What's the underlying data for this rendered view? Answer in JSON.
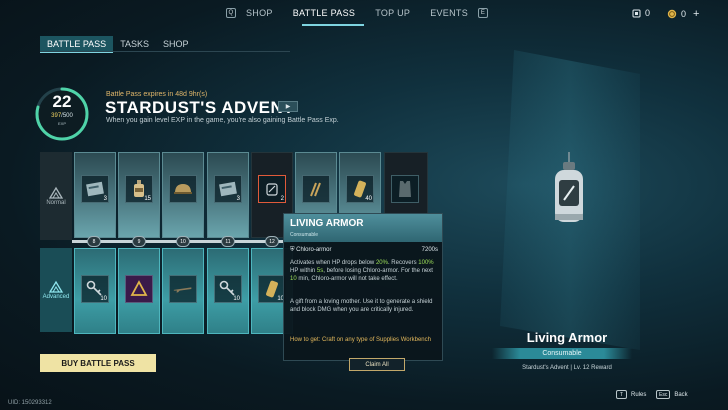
{
  "nav": {
    "left_key": "Q",
    "right_key": "E",
    "items": [
      "SHOP",
      "BATTLE PASS",
      "TOP UP",
      "EVENTS"
    ],
    "active_index": 1
  },
  "currency": [
    {
      "icon": "ticket-icon",
      "value": "0"
    },
    {
      "icon": "coin-icon",
      "value": "0"
    }
  ],
  "subnav": {
    "tabs": [
      "BATTLE PASS",
      "TASKS",
      "SHOP"
    ],
    "active_index": 0
  },
  "pass": {
    "level": "22",
    "exp_current": "397",
    "exp_sep": "/500",
    "exp_label": "EXP",
    "exp_progress": 0.794,
    "expires": "Battle Pass expires in 48d 9hr(s)",
    "title": "STARDUST'S ADVENT",
    "play_icon": "play-icon",
    "description": "When you gain level EXP in the game, you're also gaining Battle Pass Exp."
  },
  "rows": {
    "normal_label": "Normal",
    "advanced_label": "Advanced",
    "normal_items": [
      {
        "icon": "card-icon",
        "qty": "3"
      },
      {
        "icon": "bottle-icon",
        "qty": "15"
      },
      {
        "icon": "helmet-icon",
        "qty": ""
      },
      {
        "icon": "card-icon",
        "qty": "3"
      },
      {
        "icon": "chloro-armor-icon",
        "qty": "2"
      },
      {
        "icon": "ammo-icon",
        "qty": ""
      },
      {
        "icon": "canister-icon",
        "qty": "40"
      },
      {
        "icon": "armor-vest-icon",
        "qty": ""
      }
    ],
    "advanced_items": [
      {
        "icon": "key-icon",
        "qty": "10"
      },
      {
        "icon": "badge-icon",
        "qty": ""
      },
      {
        "icon": "rifle-icon",
        "qty": ""
      },
      {
        "icon": "key-icon",
        "qty": "10"
      },
      {
        "icon": "canister-icon",
        "qty": "10"
      }
    ],
    "levels": [
      "8",
      "9",
      "10",
      "11",
      "12"
    ]
  },
  "tooltip": {
    "title": "LIVING ARMOR",
    "type": "Consumable",
    "stat_name": "Chloro-armor",
    "stat_value": "7200s",
    "line1_a": "Activates when HP drops below ",
    "line1_b": "20%",
    "line1_c": ". Recovers ",
    "line2_a": "100%",
    "line2_b": " HP within ",
    "line2_c": "5s",
    "line2_d": ", before losing Chloro-armor. For the next ",
    "line2_e": "10",
    "line2_f": " min, Chloro-armor will not take effect.",
    "lore": "A gift from a loving mother. Use it to generate a shield and block DMG when you are critically injured.",
    "how_to_get": "How to get: Craft on any type of Supplies Workbench"
  },
  "buttons": {
    "buy": "BUY BATTLE PASS",
    "claim_all": "Claim All"
  },
  "uid": "UID: 150293312",
  "reward": {
    "name": "Living Armor",
    "type": "Consumable",
    "source": "Stardust's Advent | Lv. 12 Reward"
  },
  "footer": {
    "rules_key": "T",
    "rules_label": "Rules",
    "back_key": "Esc",
    "back_label": "Back"
  },
  "colors": {
    "accent": "#7ed4e0",
    "buy_button": "#efe3a4",
    "highlight_green": "#9ee05a",
    "gold": "#e3b85c"
  }
}
